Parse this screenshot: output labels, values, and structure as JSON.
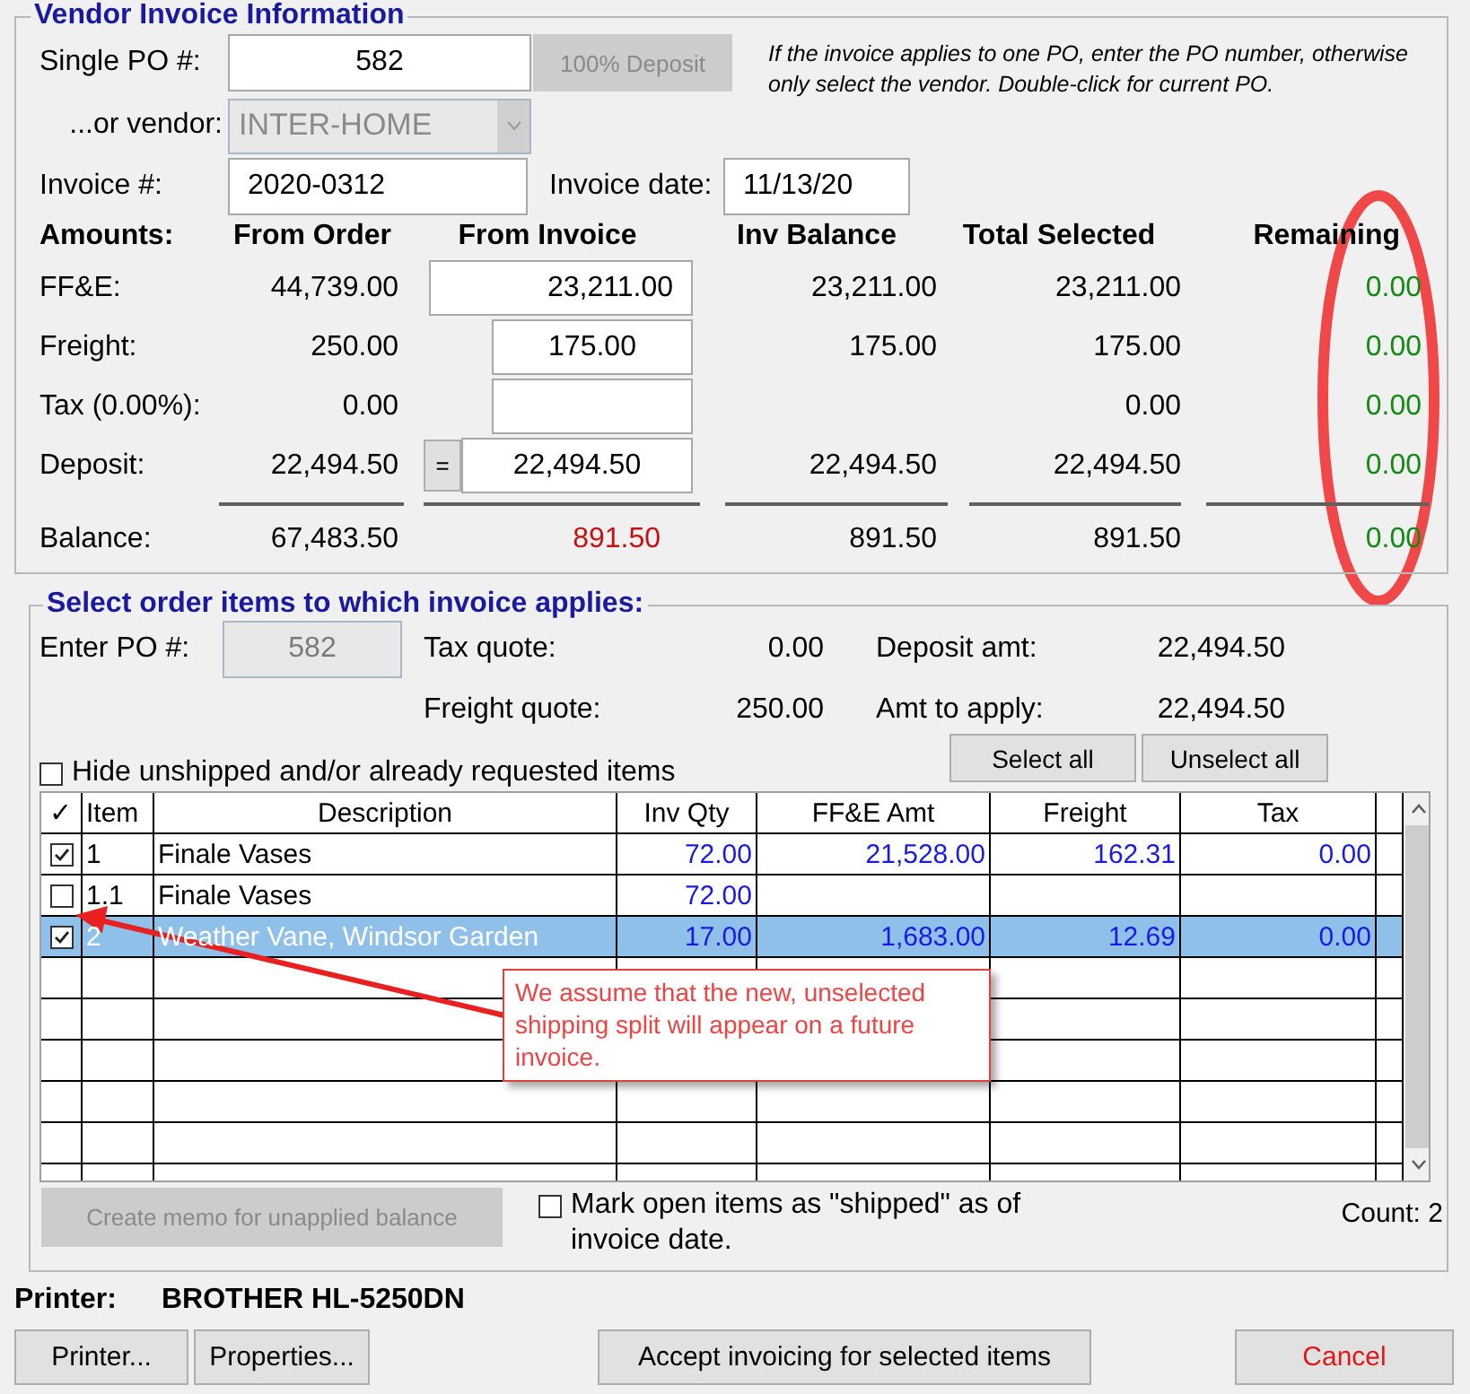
{
  "vendor_invoice": {
    "title": "Vendor Invoice Information",
    "single_po": {
      "label": "Single PO #:",
      "value": "582"
    },
    "deposit_button": {
      "label": "100% Deposit",
      "disabled": true
    },
    "hint": "If the invoice applies to one PO, enter the PO number, otherwise only select the vendor. Double-click for current PO.",
    "vendor": {
      "label": "...or vendor:",
      "value": "INTER-HOME",
      "disabled": true
    },
    "invoice_number": {
      "label": "Invoice #:",
      "value": "2020-0312"
    },
    "invoice_date": {
      "label": "Invoice date:",
      "value": "11/13/20"
    },
    "amounts": {
      "columns": [
        "Amounts:",
        "From Order",
        "From Invoice",
        "Inv Balance",
        "Total Selected",
        "Remaining"
      ],
      "rows": [
        {
          "kind": "line",
          "label": "FF&E:",
          "from_order": "44,739.00",
          "from_invoice": {
            "kind": "wide-field",
            "value": "23,211.00"
          },
          "inv_balance": "23,211.00",
          "total_selected": "23,211.00",
          "remaining": "0.00"
        },
        {
          "kind": "line",
          "label": "Freight:",
          "from_order": "250.00",
          "from_invoice": {
            "kind": "field",
            "value": "175.00"
          },
          "inv_balance": "175.00",
          "total_selected": "175.00",
          "remaining": "0.00"
        },
        {
          "kind": "line",
          "label": "Tax (0.00%):",
          "from_order": "0.00",
          "from_invoice": {
            "kind": "field"
          },
          "total_selected": "0.00",
          "remaining": "0.00"
        },
        {
          "kind": "line",
          "label": "Deposit:",
          "from_order": "22,494.50",
          "from_invoice": {
            "kind": "equals-field",
            "button": "=",
            "value": "22,494.50"
          },
          "inv_balance": "22,494.50",
          "total_selected": "22,494.50",
          "remaining": "0.00"
        },
        {
          "kind": "total",
          "label": "Balance:",
          "from_order": "67,483.50",
          "from_invoice": {
            "kind": "text",
            "value": "891.50"
          },
          "inv_balance": "891.50",
          "total_selected": "891.50",
          "remaining": "0.00"
        }
      ]
    }
  },
  "order_items": {
    "title": "Select order items to which invoice applies:",
    "po": {
      "label": "Enter PO #:",
      "value": "582",
      "disabled": true
    },
    "quotes": [
      {
        "label": "Tax quote:",
        "value": "0.00"
      },
      {
        "label": "Deposit amt:",
        "value": "22,494.50"
      },
      {
        "label": "Freight quote:",
        "value": "250.00"
      },
      {
        "label": "Amt to apply:",
        "value": "22,494.50"
      }
    ],
    "hide_checkbox": {
      "label": "Hide unshipped and/or already requested items",
      "checked": false
    },
    "buttons": [
      "Select all",
      "Unselect all"
    ],
    "table": {
      "columns": [
        "✓",
        "Item",
        "Description",
        "Inv Qty",
        "FF&E Amt",
        "Freight",
        "Tax"
      ],
      "rows": [
        {
          "checked": true,
          "selected": false,
          "item": "1",
          "description": "Finale Vases",
          "inv_qty": "72.00",
          "ffe_amt": "21,528.00",
          "freight": "162.31",
          "tax": "0.00"
        },
        {
          "checked": false,
          "selected": false,
          "item": "1.1",
          "description": "Finale Vases",
          "inv_qty": "72.00"
        },
        {
          "checked": true,
          "selected": true,
          "item": "2",
          "description": "Weather Vane, Windsor Garden",
          "inv_qty": "17.00",
          "ffe_amt": "1,683.00",
          "freight": "12.69",
          "tax": "0.00"
        }
      ]
    },
    "memo_button": {
      "label": "Create memo for unapplied balance",
      "disabled": true
    },
    "mark_checkbox": {
      "label": "Mark open items as \"shipped\" as of invoice date.",
      "checked": false
    },
    "count": "Count: 2"
  },
  "printer": {
    "label": "Printer:",
    "value": "BROTHER HL-5250DN"
  },
  "buttons": [
    {
      "label": "Printer...",
      "kind": "normal"
    },
    {
      "label": "Properties...",
      "kind": "normal"
    },
    {
      "label": "Accept invoicing for selected items",
      "kind": "normal"
    },
    {
      "label": "Cancel",
      "kind": "cancel"
    }
  ],
  "annotation": {
    "callout": "We assume that the new, unselected shipping split will appear on a future invoice."
  }
}
